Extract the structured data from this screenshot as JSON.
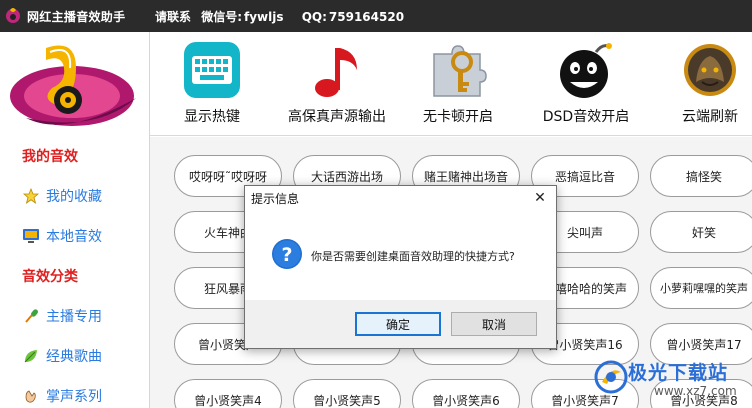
{
  "window": {
    "title": "网红主播音效助手",
    "contact_label": "请联系",
    "wechat_label": "微信号:",
    "wechat_value": "fywljs",
    "qq_label": "QQ:",
    "qq_value": "759164520"
  },
  "sidebar": {
    "section_my": "我的音效",
    "my_items": [
      {
        "label": "我的收藏",
        "icon": "star-icon"
      },
      {
        "label": "本地音效",
        "icon": "monitor-icon"
      }
    ],
    "section_category": "音效分类",
    "category_items": [
      {
        "label": "主播专用",
        "icon": "microphone-icon"
      },
      {
        "label": "经典歌曲",
        "icon": "leaf-icon"
      },
      {
        "label": "掌声系列",
        "icon": "clap-icon"
      }
    ]
  },
  "toolbar": {
    "items": [
      {
        "label": "显示热键",
        "icon": "keyboard-icon"
      },
      {
        "label": "高保真声源输出",
        "icon": "music-note-icon"
      },
      {
        "label": "无卡顿开启",
        "icon": "key-puzzle-icon"
      },
      {
        "label": "DSD音效开启",
        "icon": "bomb-face-icon"
      },
      {
        "label": "云端刷新",
        "icon": "warrior-icon"
      }
    ]
  },
  "sounds": {
    "row1": [
      "哎呀呀˜哎呀呀",
      "大话西游出场",
      "赌王赌神出场音",
      "恶搞逗比音",
      "搞怪笑"
    ],
    "row2": [
      "火车神曲",
      "",
      "",
      "尖叫声",
      "奸笑"
    ],
    "row3": [
      "狂风暴雨",
      "",
      "",
      "嘻嘻哈哈的笑声",
      "小萝莉嘿嘿的笑声"
    ],
    "row4": [
      "曾小贤笑声",
      "",
      "",
      "曾小贤笑声16",
      "曾小贤笑声17"
    ],
    "row5": [
      "曾小贤笑声4",
      "曾小贤笑声5",
      "曾小贤笑声6",
      "曾小贤笑声7",
      "曾小贤笑声8"
    ]
  },
  "dialog": {
    "title": "提示信息",
    "close": "✕",
    "message": "你是否需要创建桌面音效助理的快捷方式?",
    "ok": "确定",
    "cancel": "取消",
    "icon": "question-icon"
  },
  "watermark": {
    "brand": "极光下载站",
    "url": "www.xz7.com"
  },
  "colors": {
    "titlebar": "#2b2b2b",
    "section_title": "#e02020",
    "sidebar_link": "#2a7be0",
    "dialog_ok_border": "#1a74d4",
    "watermark": "#2b6fd6"
  }
}
